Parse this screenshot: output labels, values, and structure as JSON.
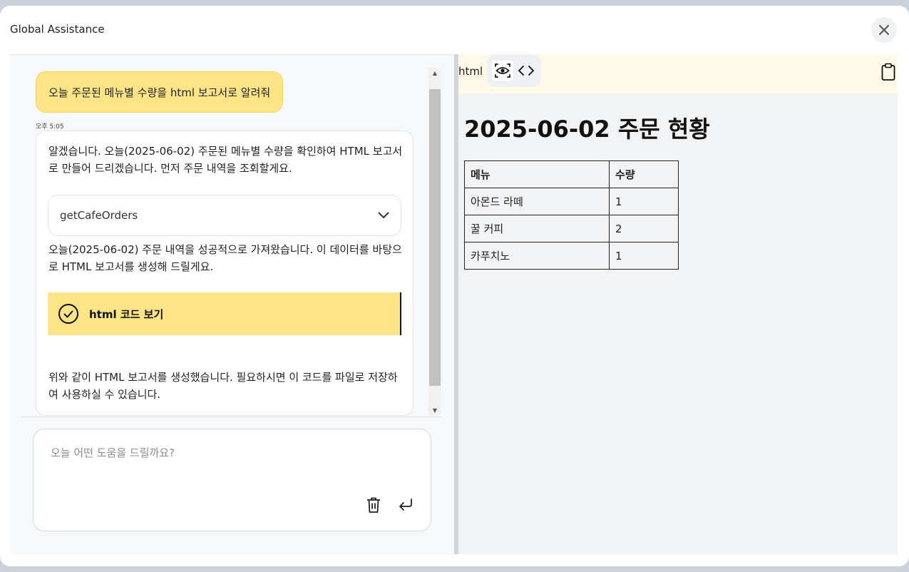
{
  "window": {
    "title": "Global Assistance",
    "close_icon": "close-icon"
  },
  "chat": {
    "user_message": "오늘 주문된 메뉴별 수량을 html 보고서로 알려줘",
    "timestamp": "오후 5:05",
    "assistant": {
      "intro": "알겠습니다. 오늘(2025-06-02) 주문된 메뉴별 수량을 확인하여 HTML 보고서로 만들어 드리겠습니다. 먼저 주문 내역을 조회할게요.",
      "tool_call": "getCafeOrders",
      "after_tool": "오늘(2025-06-02) 주문 내역을 성공적으로 가져왔습니다. 이 데이터를 바탕으로 HTML 보고서를 생성해 드릴게요.",
      "code_block_label": "html 코드 보기",
      "outro": "위와 같이 HTML 보고서를 생성했습니다. 필요하시면 이 코드를 파일로 저장하여 사용하실 수 있습니다."
    }
  },
  "input": {
    "placeholder": "오늘 어떤 도움을 드릴까요?",
    "value": ""
  },
  "preview": {
    "language": "html",
    "title": "2025-06-02 주문 현황",
    "table": {
      "headers": [
        "메뉴",
        "수량"
      ],
      "rows": [
        [
          "아몬드 라떼",
          "1"
        ],
        [
          "꿀 커피",
          "2"
        ],
        [
          "카푸치노",
          "1"
        ]
      ]
    }
  },
  "colors": {
    "accent_yellow": "#fde587",
    "preview_bar": "#fdf9e6"
  }
}
